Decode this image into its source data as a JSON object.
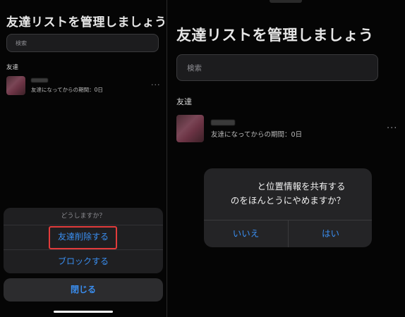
{
  "left": {
    "title": "友達リストを管理しましょう",
    "search_placeholder": "検索",
    "section_label": "友達",
    "friend_meta": "友達になってからの期間：0日",
    "more_icon": "ellipsis-icon",
    "action_sheet": {
      "header": "どうしますか？",
      "delete_label": "友達削除する",
      "block_label": "ブロックする",
      "close_label": "閉じる"
    }
  },
  "right": {
    "title": "友達リストを管理しましょう",
    "search_placeholder": "検索",
    "section_label": "友達",
    "friend_meta": "友達になってからの期間：0日",
    "more_icon": "ellipsis-icon",
    "alert": {
      "line1": "と位置情報を共有する",
      "line2": "のをほんとうにやめますか？",
      "no_label": "いいえ",
      "yes_label": "はい"
    }
  },
  "colors": {
    "accent": "#3a8ef0",
    "highlight_border": "#e23b3b",
    "background": "#050505"
  }
}
